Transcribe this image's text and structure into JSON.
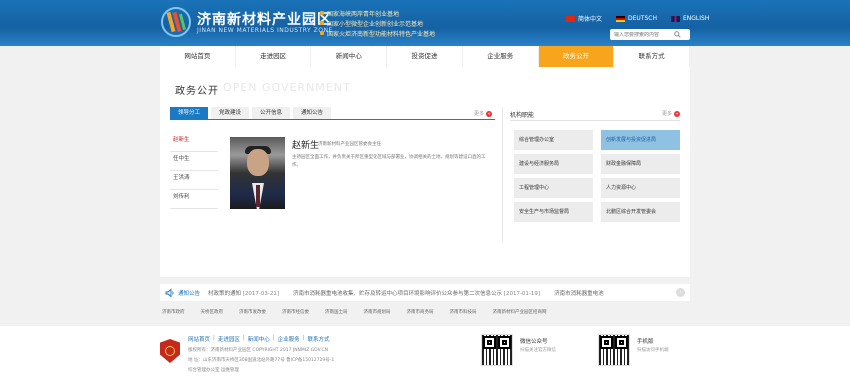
{
  "header": {
    "title": "济南新材料产业园区",
    "subtitle": "JINAN NEW MATERIALS INDUSTRY ZONE",
    "slogans": [
      "国家海峡两岸青年创业基地",
      "国家小型微型企业创新创业示范基地",
      "国家火炬济南新型功能材料特色产业基地"
    ],
    "languages": [
      "简体中文",
      "DEUTSCH",
      "ENGLISH"
    ],
    "search_placeholder": "输入您要搜索的内容",
    "colors": {
      "primary": "#1a73b8",
      "accent": "#f7a51c"
    }
  },
  "nav": {
    "items": [
      "网站首页",
      "走进园区",
      "新闻中心",
      "投资促进",
      "企业服务",
      "政务公开",
      "联系方式"
    ],
    "active_index": 5
  },
  "page": {
    "title": "政务公开",
    "title_en": "OPEN GOVERNMENT"
  },
  "tabs": [
    "领导分工",
    "党政建设",
    "公开信息",
    "通知公告"
  ],
  "more_label": "更多",
  "leaders": [
    "赵新生",
    "任中生",
    "王洪涛",
    "刘传利"
  ],
  "profile": {
    "name": "赵新生",
    "role": "济南新材料产业园区管委会主任",
    "description": "主持园区全面工作，并负责关于所区重型化区域与部署业，协调相关的土地、规划等建设口直的工作。"
  },
  "org": {
    "title": "机构职能",
    "items": [
      "综合管理办公室",
      "创新发展与投资促进局",
      "建设与经济服务局",
      "财政金融保障局",
      "工程管理中心",
      "人力资源中心",
      "安全生产与市场监督局",
      "北鹏区综合开发管委会"
    ],
    "active_index": 1
  },
  "notice": {
    "label": "通知公告",
    "items": [
      {
        "text": "村政策的通知",
        "date": "[2017-03-21]"
      },
      {
        "text": "济南市消耗器重电池收集、贮存及转运中心项目环境影响评价公众参与第二次信息公示",
        "date": "[2017-01-19]"
      },
      {
        "text": "济南市消耗器重电池",
        "date": ""
      }
    ]
  },
  "links": [
    "济南市政府",
    "天桥区政府",
    "济南市发改委",
    "济南市经信委",
    "济南国土局",
    "济南市规划局",
    "济南市商务局",
    "济南市科技局",
    "济南新材料产业园区招商网"
  ],
  "footer": {
    "nav": [
      "网站首页",
      "走进园区",
      "新闻中心",
      "企业服务",
      "联系方式"
    ],
    "copyright": "版权所有：济南新材料产业园区 COPYRIGHT 2017 JNNMIZ.GOV.CN",
    "address": "地 址：山东济南市天桥区308国道北站外路77号 鲁ICP备15012729号-1",
    "admin": "综合管理办公室 运维管理",
    "qr1_title": "微信公众号",
    "qr1_sub": "扫描关注官方微信",
    "qr2_title": "手机版",
    "qr2_sub": "扫描访问手机端"
  }
}
